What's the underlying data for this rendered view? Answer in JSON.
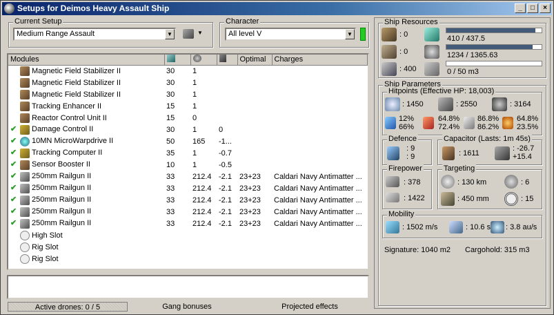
{
  "window": {
    "title": "Setups for Deimos Heavy Assault Ship"
  },
  "setup": {
    "label": "Current Setup",
    "value": "Medium Range Assault"
  },
  "character": {
    "label": "Character",
    "value": "All level V",
    "indicator_color": "#22cc22"
  },
  "modules": {
    "headers": [
      "Modules",
      "",
      "",
      "",
      "Optimal",
      "Charges"
    ],
    "rows": [
      {
        "active": false,
        "icon": "magnetic-field-icon",
        "name": "Magnetic Field Stabilizer II",
        "cpu": "30",
        "pg": "1",
        "c3": "",
        "opt": "",
        "charges": ""
      },
      {
        "active": false,
        "icon": "magnetic-field-icon",
        "name": "Magnetic Field Stabilizer II",
        "cpu": "30",
        "pg": "1",
        "c3": "",
        "opt": "",
        "charges": ""
      },
      {
        "active": false,
        "icon": "magnetic-field-icon",
        "name": "Magnetic Field Stabilizer II",
        "cpu": "30",
        "pg": "1",
        "c3": "",
        "opt": "",
        "charges": ""
      },
      {
        "active": false,
        "icon": "tracking-enhancer-icon",
        "name": "Tracking Enhancer II",
        "cpu": "15",
        "pg": "1",
        "c3": "",
        "opt": "",
        "charges": ""
      },
      {
        "active": false,
        "icon": "reactor-control-icon",
        "name": "Reactor Control Unit II",
        "cpu": "15",
        "pg": "0",
        "c3": "",
        "opt": "",
        "charges": ""
      },
      {
        "active": true,
        "icon": "damage-control-icon",
        "name": "Damage Control II",
        "cpu": "30",
        "pg": "1",
        "c3": "0",
        "opt": "",
        "charges": ""
      },
      {
        "active": true,
        "icon": "microwarpdrive-icon",
        "name": "10MN MicroWarpdrive II",
        "cpu": "50",
        "pg": "165",
        "c3": "-1...",
        "opt": "",
        "charges": ""
      },
      {
        "active": true,
        "icon": "tracking-computer-icon",
        "name": "Tracking Computer II",
        "cpu": "35",
        "pg": "1",
        "c3": "-0.7",
        "opt": "",
        "charges": ""
      },
      {
        "active": true,
        "icon": "sensor-booster-icon",
        "name": "Sensor Booster II",
        "cpu": "10",
        "pg": "1",
        "c3": "-0.5",
        "opt": "",
        "charges": ""
      },
      {
        "active": true,
        "icon": "railgun-icon",
        "name": "250mm Railgun II",
        "cpu": "33",
        "pg": "212.4",
        "c3": "-2.1",
        "opt": "23+23",
        "charges": "Caldari Navy Antimatter ..."
      },
      {
        "active": true,
        "icon": "railgun-icon",
        "name": "250mm Railgun II",
        "cpu": "33",
        "pg": "212.4",
        "c3": "-2.1",
        "opt": "23+23",
        "charges": "Caldari Navy Antimatter ..."
      },
      {
        "active": true,
        "icon": "railgun-icon",
        "name": "250mm Railgun II",
        "cpu": "33",
        "pg": "212.4",
        "c3": "-2.1",
        "opt": "23+23",
        "charges": "Caldari Navy Antimatter ..."
      },
      {
        "active": true,
        "icon": "railgun-icon",
        "name": "250mm Railgun II",
        "cpu": "33",
        "pg": "212.4",
        "c3": "-2.1",
        "opt": "23+23",
        "charges": "Caldari Navy Antimatter ..."
      },
      {
        "active": true,
        "icon": "railgun-icon",
        "name": "250mm Railgun II",
        "cpu": "33",
        "pg": "212.4",
        "c3": "-2.1",
        "opt": "23+23",
        "charges": "Caldari Navy Antimatter ..."
      },
      {
        "active": false,
        "icon": "high-slot-icon",
        "name": "High Slot",
        "cpu": "",
        "pg": "",
        "c3": "",
        "opt": "",
        "charges": ""
      },
      {
        "active": false,
        "icon": "rig-slot-icon",
        "name": "Rig Slot",
        "cpu": "",
        "pg": "",
        "c3": "",
        "opt": "",
        "charges": ""
      },
      {
        "active": false,
        "icon": "rig-slot-icon",
        "name": "Rig Slot",
        "cpu": "",
        "pg": "",
        "c3": "",
        "opt": "",
        "charges": ""
      }
    ]
  },
  "status": {
    "drones": "Active drones: 0 / 5",
    "gang": "Gang bonuses",
    "projected": "Projected effects"
  },
  "resources": {
    "label": "Ship Resources",
    "turret": ": 0",
    "launcher": ": 0",
    "calibration": ": 400",
    "cpu": "410 / 437.5",
    "cpu_fraction": 0.937,
    "powergrid": "1234 / 1365.63",
    "powergrid_fraction": 0.904,
    "drone_bay": "0 / 50 m3",
    "drone_fraction": 0.0
  },
  "params": {
    "label": "Ship Parameters",
    "hitpoints_label": "Hitpoints (Effective HP: 18,003)",
    "shield_hp": ": 1450",
    "armor_hp": ": 2550",
    "structure_hp": ": 3164",
    "shield_res": [
      "12%",
      "66%"
    ],
    "armor_res": [
      "64.8%",
      "72.4%"
    ],
    "kin_res": [
      "86.8%",
      "86.2%"
    ],
    "exp_res": [
      "64.8%",
      "23.5%"
    ],
    "defence_label": "Defence",
    "defence": [
      ": 9",
      ": 9"
    ],
    "capacitor_label": "Capacitor (Lasts: 1m 45s)",
    "cap_amount": ": 1611",
    "cap_delta": [
      ": -26.7",
      "+15.4"
    ],
    "firepower_label": "Firepower",
    "dps": ": 378",
    "volley": ": 1422",
    "targeting_label": "Targeting",
    "range": ": 130 km",
    "max_targets": ": 6",
    "scan_res": ": 450 mm",
    "sensor": ": 15",
    "mobility_label": "Mobility",
    "speed": ": 1502 m/s",
    "align": ": 10.6 s",
    "warp": ": 3.8 au/s",
    "signature": "Signature: 1040 m2",
    "cargohold": "Cargohold: 315 m3"
  }
}
